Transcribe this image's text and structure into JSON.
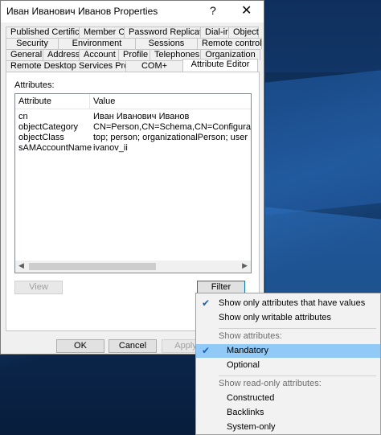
{
  "window": {
    "title": "Иван Иванович Иванов Properties",
    "help": "?",
    "close": "✕"
  },
  "tabs": {
    "row1": [
      "Published Certificates",
      "Member Of",
      "Password Replication",
      "Dial-in",
      "Object"
    ],
    "row2": [
      "Security",
      "Environment",
      "Sessions",
      "Remote control"
    ],
    "row3": [
      "General",
      "Address",
      "Account",
      "Profile",
      "Telephones",
      "Organization"
    ],
    "row4": [
      "Remote Desktop Services Profile",
      "COM+",
      "Attribute Editor"
    ],
    "active": "Attribute Editor"
  },
  "panel": {
    "attributes_label": "Attributes:",
    "columns": [
      "Attribute",
      "Value"
    ],
    "rows": [
      {
        "attribute": "cn",
        "value": "Иван Иванович Иванов"
      },
      {
        "attribute": "objectCategory",
        "value": "CN=Person,CN=Schema,CN=Configuration,DC=t"
      },
      {
        "attribute": "objectClass",
        "value": "top; person; organizationalPerson; user"
      },
      {
        "attribute": "sAMAccountName",
        "value": "ivanov_ii"
      }
    ],
    "view_button": "View",
    "filter_button": "Filter"
  },
  "footer": {
    "ok": "OK",
    "cancel": "Cancel",
    "apply": "Apply"
  },
  "menu": {
    "items": [
      {
        "label": "Show only attributes that have values",
        "checked": true
      },
      {
        "label": "Show only writable attributes",
        "checked": false
      }
    ],
    "header_show": "Show attributes:",
    "show_items": [
      {
        "label": "Mandatory",
        "checked": true
      },
      {
        "label": "Optional",
        "checked": false
      }
    ],
    "header_readonly": "Show read-only attributes:",
    "readonly_items": [
      {
        "label": "Constructed"
      },
      {
        "label": "Backlinks"
      },
      {
        "label": "System-only"
      }
    ]
  },
  "colors": {
    "selection": "#91c9f7",
    "check": "#1a5fb4",
    "desktop": "#123b6e"
  }
}
